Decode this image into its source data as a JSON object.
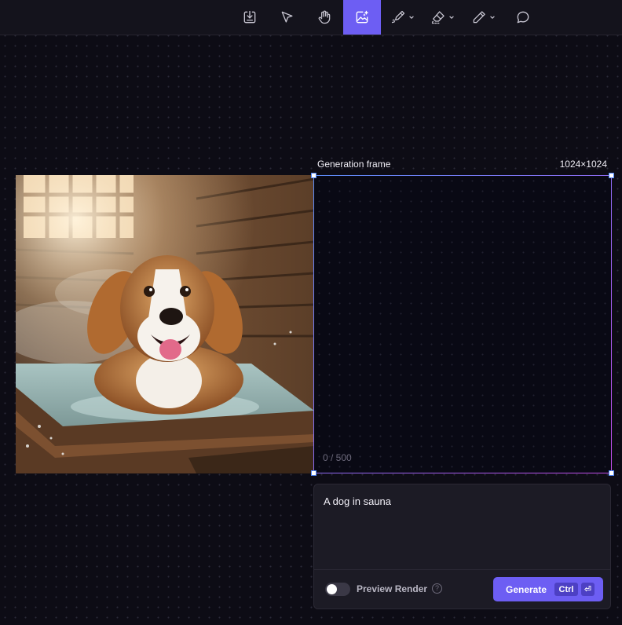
{
  "toolbar": {
    "tools": [
      {
        "icon": "import-icon",
        "active": false
      },
      {
        "icon": "select-arrow-icon",
        "active": false
      },
      {
        "icon": "hand-pan-icon",
        "active": false
      },
      {
        "icon": "generate-image-icon",
        "active": true
      },
      {
        "icon": "brush-icon",
        "active": false,
        "has_dropdown": true
      },
      {
        "icon": "eraser-icon",
        "active": false,
        "has_dropdown": true
      },
      {
        "icon": "pencil-icon",
        "active": false,
        "has_dropdown": true
      },
      {
        "icon": "comment-icon",
        "active": false
      }
    ],
    "accent_color": "#6d5ef3"
  },
  "canvas": {
    "image_alt": "Dog in sauna",
    "frame_label": "Generation frame",
    "frame_size": "1024×1024",
    "char_counter": "0 / 500"
  },
  "prompt": {
    "text": "A dog in sauna",
    "preview_render_label": "Preview Render",
    "preview_render_enabled": false,
    "help_symbol": "?",
    "generate_label": "Generate",
    "shortcut_key": "Ctrl",
    "enter_symbol": "⏎"
  }
}
